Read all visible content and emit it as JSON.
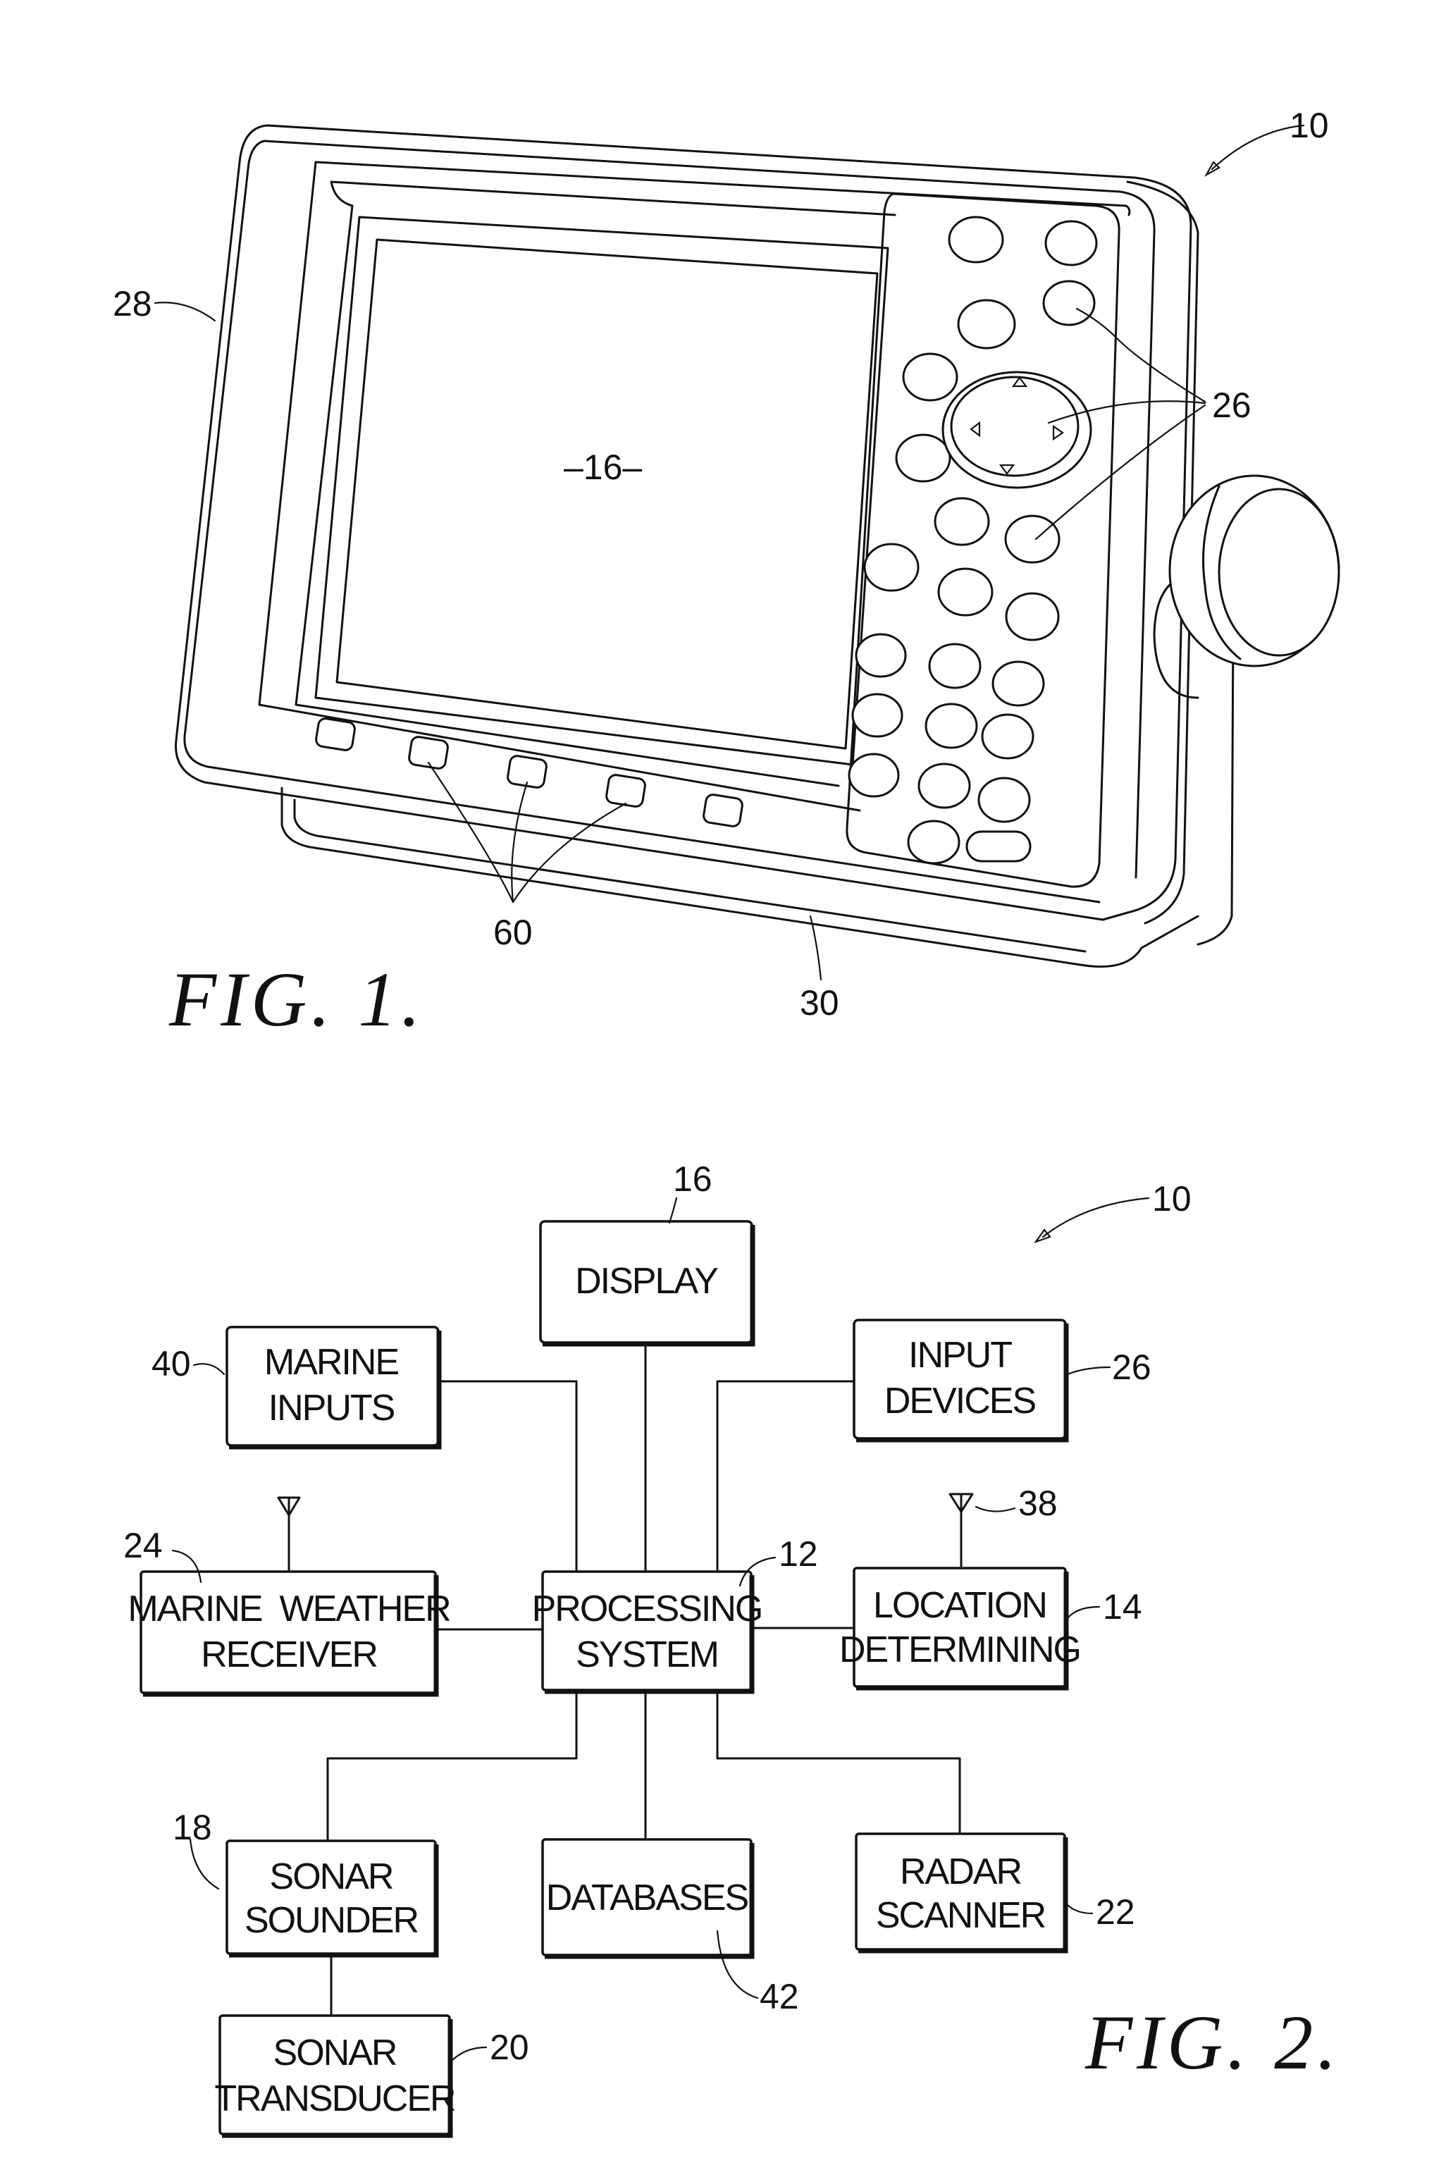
{
  "figures": [
    {
      "id": "fig1",
      "caption": "FIG. 1.",
      "description": "Perspective view of marine electronic device",
      "reference_numerals": {
        "device": "10",
        "screen": "–16–",
        "housing": "28",
        "input_devices": "26",
        "soft_keys": "60",
        "bracket": "30"
      },
      "soft_key_count": 5,
      "keypad_button_count": 21
    },
    {
      "id": "fig2",
      "caption": "FIG. 2.",
      "description": "Block diagram of marine electronic device",
      "device_ref": "10",
      "blocks": [
        {
          "id": "display",
          "ref": "16",
          "lines": [
            "DISPLAY"
          ]
        },
        {
          "id": "marine_inputs",
          "ref": "40",
          "lines": [
            "MARINE",
            "INPUTS"
          ]
        },
        {
          "id": "input_devices",
          "ref": "26",
          "lines": [
            "INPUT",
            "DEVICES"
          ]
        },
        {
          "id": "marine_weather_receiver",
          "ref": "24",
          "lines": [
            "MARINE  WEATHER",
            "RECEIVER"
          ]
        },
        {
          "id": "processing_system",
          "ref": "12",
          "lines": [
            "PROCESSING",
            "SYSTEM"
          ]
        },
        {
          "id": "location_determining",
          "ref": "14",
          "lines": [
            "LOCATION",
            "DETERMINING"
          ]
        },
        {
          "id": "sonar_sounder",
          "ref": "18",
          "lines": [
            "SONAR",
            "SOUNDER"
          ]
        },
        {
          "id": "databases",
          "ref": "42",
          "lines": [
            "DATABASES"
          ]
        },
        {
          "id": "radar_scanner",
          "ref": "22",
          "lines": [
            "RADAR",
            "SCANNER"
          ]
        },
        {
          "id": "sonar_transducer",
          "ref": "20",
          "lines": [
            "SONAR",
            "TRANSDUCER"
          ]
        }
      ],
      "antennas": [
        {
          "attached_to": "marine_weather_receiver",
          "ref": ""
        },
        {
          "attached_to": "location_determining",
          "ref": "38"
        }
      ],
      "connections": [
        [
          "processing_system",
          "display"
        ],
        [
          "processing_system",
          "marine_inputs"
        ],
        [
          "processing_system",
          "input_devices"
        ],
        [
          "processing_system",
          "marine_weather_receiver"
        ],
        [
          "processing_system",
          "location_determining"
        ],
        [
          "processing_system",
          "sonar_sounder"
        ],
        [
          "processing_system",
          "databases"
        ],
        [
          "processing_system",
          "radar_scanner"
        ],
        [
          "sonar_sounder",
          "sonar_transducer"
        ]
      ]
    }
  ]
}
